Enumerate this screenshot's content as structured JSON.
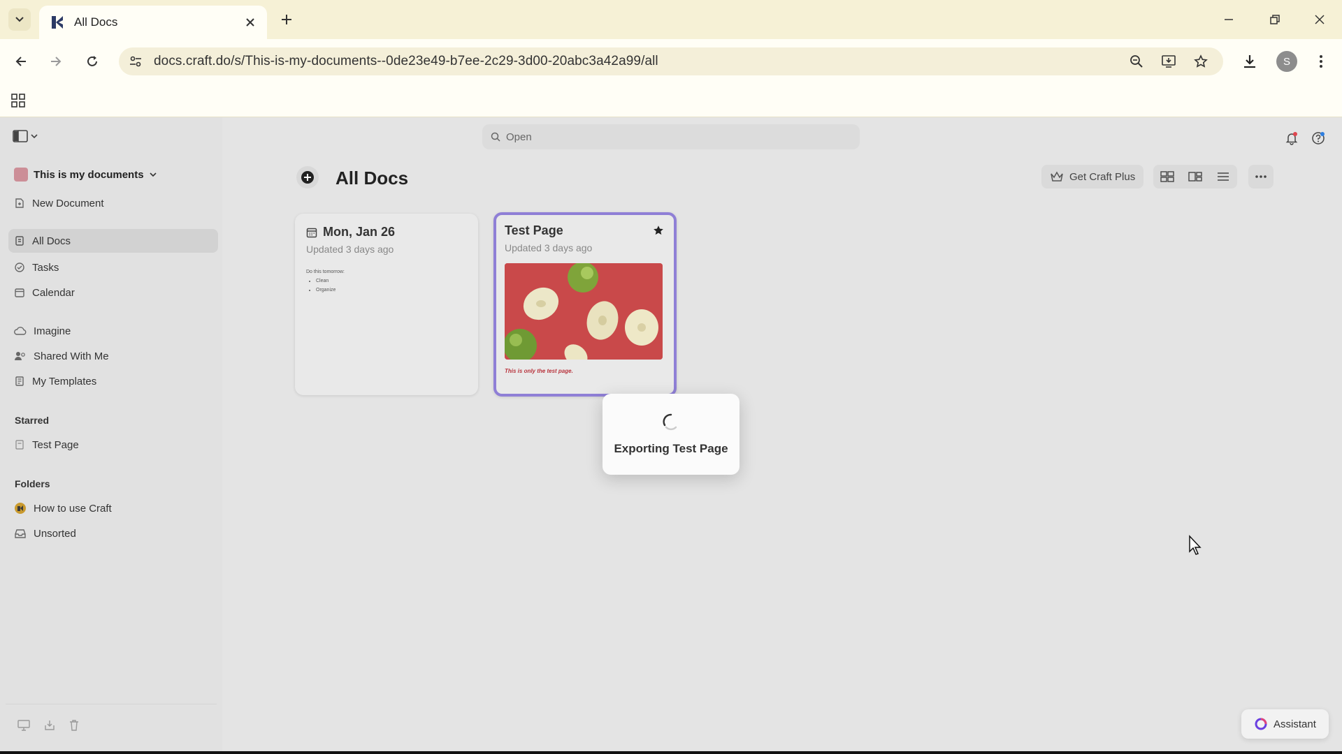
{
  "browser": {
    "tab_title": "All Docs",
    "url": "docs.craft.do/s/This-is-my-documents--0de23e49-b7ee-2c29-3d00-20abc3a42a99/all",
    "avatar_letter": "S"
  },
  "app": {
    "search_placeholder": "Open",
    "workspace_name": "This is my documents",
    "page_title": "All Docs",
    "get_plus_label": "Get Craft Plus",
    "assistant_label": "Assistant",
    "sidebar": {
      "new_document": "New Document",
      "main_items": [
        {
          "label": "All Docs",
          "icon": "docs-icon",
          "active": true
        },
        {
          "label": "Tasks",
          "icon": "tasks-icon"
        },
        {
          "label": "Calendar",
          "icon": "calendar-icon"
        }
      ],
      "secondary_items": [
        {
          "label": "Imagine",
          "icon": "cloud-icon"
        },
        {
          "label": "Shared With Me",
          "icon": "shared-icon"
        },
        {
          "label": "My Templates",
          "icon": "template-icon"
        }
      ],
      "starred_heading": "Starred",
      "starred_items": [
        {
          "label": "Test Page",
          "icon": "page-icon"
        }
      ],
      "folders_heading": "Folders",
      "folder_items": [
        {
          "label": "How to use Craft",
          "icon": "craft-folder-icon"
        },
        {
          "label": "Unsorted",
          "icon": "inbox-icon"
        }
      ]
    },
    "cards": [
      {
        "title": "Mon, Jan 26",
        "subtitle": "Updated 3 days ago",
        "preview_heading": "Do this tomorrow:",
        "preview_items": [
          "Clean",
          "Organize"
        ]
      },
      {
        "title": "Test Page",
        "subtitle": "Updated 3 days ago",
        "starred": true,
        "caption": "This is only the test page."
      }
    ],
    "toast": {
      "text": "Exporting Test Page"
    }
  },
  "colors": {
    "chrome_bg": "#f6f1d6",
    "selected_card_border": "#8f7fd6",
    "image_bg": "#c9494a",
    "caption": "#b8333c"
  }
}
